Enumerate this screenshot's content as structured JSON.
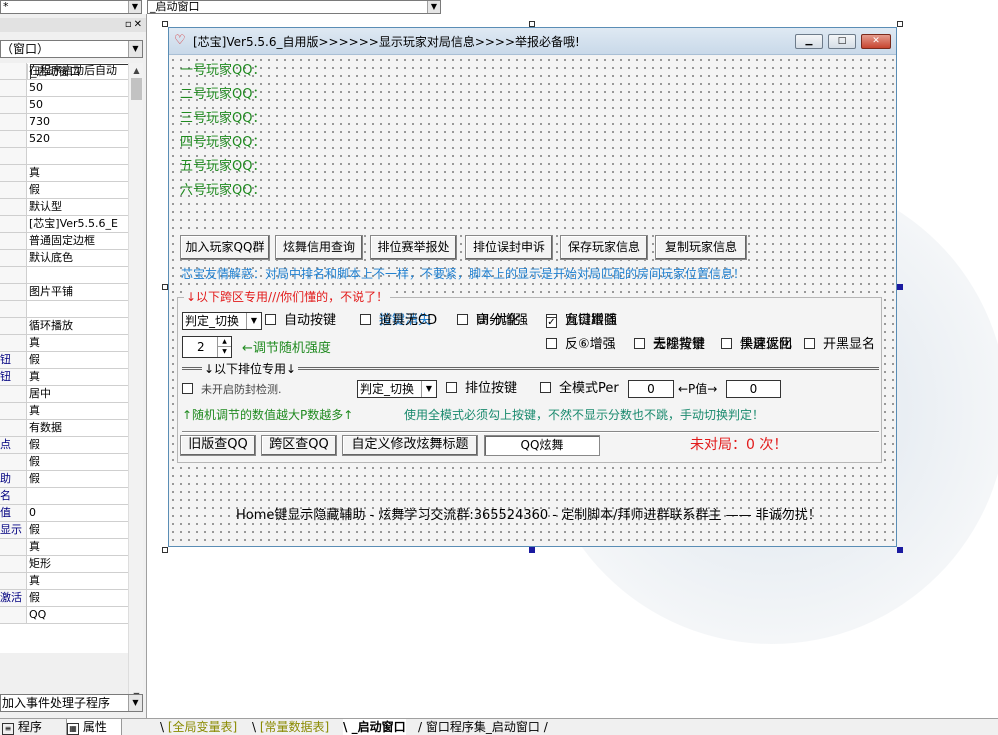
{
  "top_combos": {
    "left_value": "*",
    "right_value": "_启动窗口"
  },
  "property_panel": {
    "selected_object": "（窗口）",
    "rows": [
      {
        "name": "",
        "value": "_启动窗口"
      },
      {
        "name": "",
        "value": "在程序启动后自动"
      },
      {
        "name": "",
        "value": "50"
      },
      {
        "name": "",
        "value": "50"
      },
      {
        "name": "",
        "value": "730"
      },
      {
        "name": "",
        "value": "520"
      },
      {
        "name": "",
        "value": ""
      },
      {
        "name": "",
        "value": "真"
      },
      {
        "name": "",
        "value": "假"
      },
      {
        "name": "",
        "value": "默认型"
      },
      {
        "name": "",
        "value": "[芯宝]Ver5.5.6_E"
      },
      {
        "name": "",
        "value": "普通固定边框"
      },
      {
        "name": "",
        "value": "默认底色"
      },
      {
        "name": "",
        "value": ""
      },
      {
        "name": "",
        "value": "图片平铺"
      },
      {
        "name": "",
        "value": ""
      },
      {
        "name": "",
        "value": "循环播放"
      },
      {
        "name": "",
        "value": "真"
      },
      {
        "name": "钮",
        "value": "假"
      },
      {
        "name": "钮",
        "value": "真"
      },
      {
        "name": "",
        "value": "居中"
      },
      {
        "name": "",
        "value": "真"
      },
      {
        "name": "",
        "value": "有数据"
      },
      {
        "name": "点",
        "value": "假"
      },
      {
        "name": "",
        "value": "假"
      },
      {
        "name": "助",
        "value": "假"
      },
      {
        "name": "名",
        "value": ""
      },
      {
        "name": "值",
        "value": "0"
      },
      {
        "name": "显示",
        "value": "假"
      },
      {
        "name": "",
        "value": "真"
      },
      {
        "name": "",
        "value": "矩形"
      },
      {
        "name": "",
        "value": "真"
      },
      {
        "name": "激活",
        "value": "假"
      },
      {
        "name": "",
        "value": "QQ"
      }
    ],
    "event_combo": "加入事件处理子程序",
    "tabs": [
      "程序",
      "属性"
    ]
  },
  "bottom_tabs": [
    "[全局变量表]",
    "[常量数据表]",
    "_启动窗口",
    "窗口程序集_启动窗口"
  ],
  "design_window": {
    "title": "[芯宝]Ver5.5.6_自用版>>>>>>显示玩家对局信息>>>>举报必备哦!",
    "players": [
      "一号玩家QQ：",
      "二号玩家QQ：",
      "三号玩家QQ：",
      "四号玩家QQ：",
      "五号玩家QQ：",
      "六号玩家QQ："
    ],
    "buttons": [
      "加入玩家QQ群",
      "炫舞信用查询",
      "排位赛举报处",
      "排位误封申诉",
      "保存玩家信息",
      "复制玩家信息"
    ],
    "info_line": "芯宝友情解惑：对局中排名和脚本上不一样，不要紧，脚本上的显示是开始对局匹配的房间玩家位置信息！",
    "cross_section_header": "↓以下跨区专用///你们懂的，不说了！",
    "mode_select": "判定_切换",
    "row1_checks": [
      {
        "label": "自动按键",
        "checked": false
      },
      {
        "label": "按键消失",
        "checked": false
      },
      {
        "label": "高分增强",
        "checked": false
      },
      {
        "label": "九键增强",
        "checked": false
      },
      {
        "label": "道具无CD",
        "checked": false
      },
      {
        "label": "UI-优化",
        "checked": false
      },
      {
        "label": "窗口跟随",
        "checked": true
      }
    ],
    "spin_value": "2",
    "spin_hint": "←调节随机强度",
    "row2_checks": [
      {
        "label": "去除背景",
        "checked": false
      },
      {
        "label": "快速返回",
        "checked": false
      },
      {
        "label": "开黑显名",
        "checked": false
      },
      {
        "label": "反⑥增强",
        "checked": false
      },
      {
        "label": "无视按键",
        "checked": false
      },
      {
        "label": "黑屏优化",
        "checked": false
      }
    ],
    "rank_header": "↓以下排位专用↓",
    "anti_seal_check": "未开启防封检测.",
    "rank_select": "判定_切换",
    "rank_key_check": "排位按键",
    "full_mode_check": "全模式Per",
    "per_value": "0",
    "p_label": "←P值→",
    "p_value": "0",
    "random_hint": "↑随机调节的数值越大P数越多↑",
    "full_mode_hint": "使用全模式必须勾上按键，不然不显示分数也不跳，手动切换判定！",
    "bottom_buttons": [
      "旧版查QQ",
      "跨区查QQ",
      "自定义修改炫舞标题"
    ],
    "qq_field": "QQ炫舞",
    "status": "未对局：0 次！",
    "footer": "Home键显示隐藏辅助 - 炫舞学习交流群:365524360 - 定制脚本/拜师进群联系群主 —— 非诚勿扰！"
  }
}
